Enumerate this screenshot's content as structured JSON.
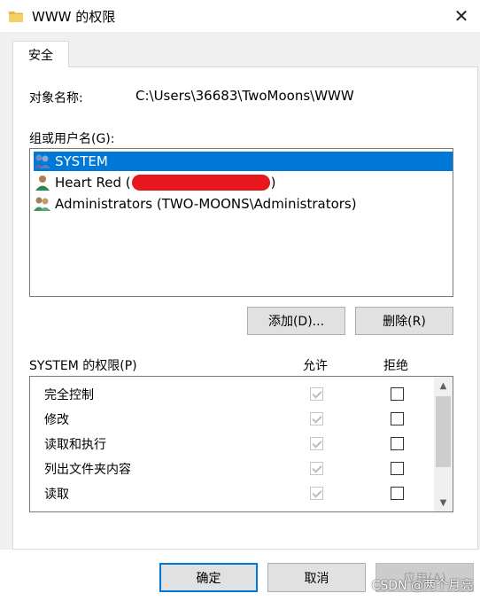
{
  "window": {
    "title": "WWW 的权限",
    "folder_icon": "folder-icon",
    "close_glyph": "✕"
  },
  "tabs": [
    {
      "label": "安全"
    }
  ],
  "object": {
    "label": "对象名称:",
    "value": "C:\\Users\\36683\\TwoMoons\\WWW"
  },
  "groups": {
    "label": "组或用户名(G):",
    "items": [
      {
        "name": "SYSTEM",
        "icon": "group-icon",
        "selected": true
      },
      {
        "name": "Heart Red (",
        "suffix": ")",
        "icon": "user-icon",
        "redacted": true
      },
      {
        "name": "Administrators (TWO-MOONS\\Administrators)",
        "icon": "group-icon"
      }
    ]
  },
  "buttons": {
    "add": "添加(D)...",
    "remove": "删除(R)",
    "ok": "确定",
    "cancel": "取消",
    "apply": "应用(A)"
  },
  "permissions": {
    "label": "SYSTEM 的权限(P)",
    "allow_header": "允许",
    "deny_header": "拒绝",
    "rows": [
      {
        "name": "完全控制",
        "allow": true,
        "allow_disabled": true,
        "deny": false
      },
      {
        "name": "修改",
        "allow": true,
        "allow_disabled": true,
        "deny": false
      },
      {
        "name": "读取和执行",
        "allow": true,
        "allow_disabled": true,
        "deny": false
      },
      {
        "name": "列出文件夹内容",
        "allow": true,
        "allow_disabled": true,
        "deny": false
      },
      {
        "name": "读取",
        "allow": true,
        "allow_disabled": true,
        "deny": false
      }
    ]
  },
  "watermark": "CSDN @两个月亮",
  "colors": {
    "selection": "#0078d7",
    "redaction": "#e8161d",
    "dialog_bg": "#f0f0f0"
  }
}
